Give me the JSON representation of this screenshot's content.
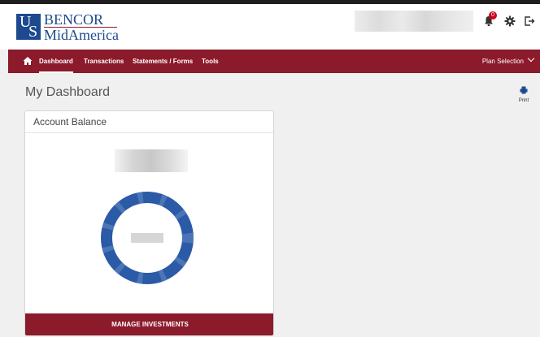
{
  "logo": {
    "us_u": "U",
    "us_s": "S",
    "line1": "BENCOR",
    "line2": "MidAmerica"
  },
  "header": {
    "notification_count": "0"
  },
  "nav": {
    "items": [
      {
        "label": "Dashboard",
        "active": true
      },
      {
        "label": "Transactions"
      },
      {
        "label": "Statements / Forms"
      },
      {
        "label": "Tools"
      }
    ],
    "plan_selection": "Plan Selection"
  },
  "page": {
    "title": "My Dashboard",
    "print_label": "Print"
  },
  "card": {
    "title": "Account Balance",
    "button": "MANAGE INVESTMENTS"
  },
  "colors": {
    "brand": "#8b1a2b",
    "logo_blue": "#1d4a8e",
    "donut_blue": "#2b5aa6"
  }
}
